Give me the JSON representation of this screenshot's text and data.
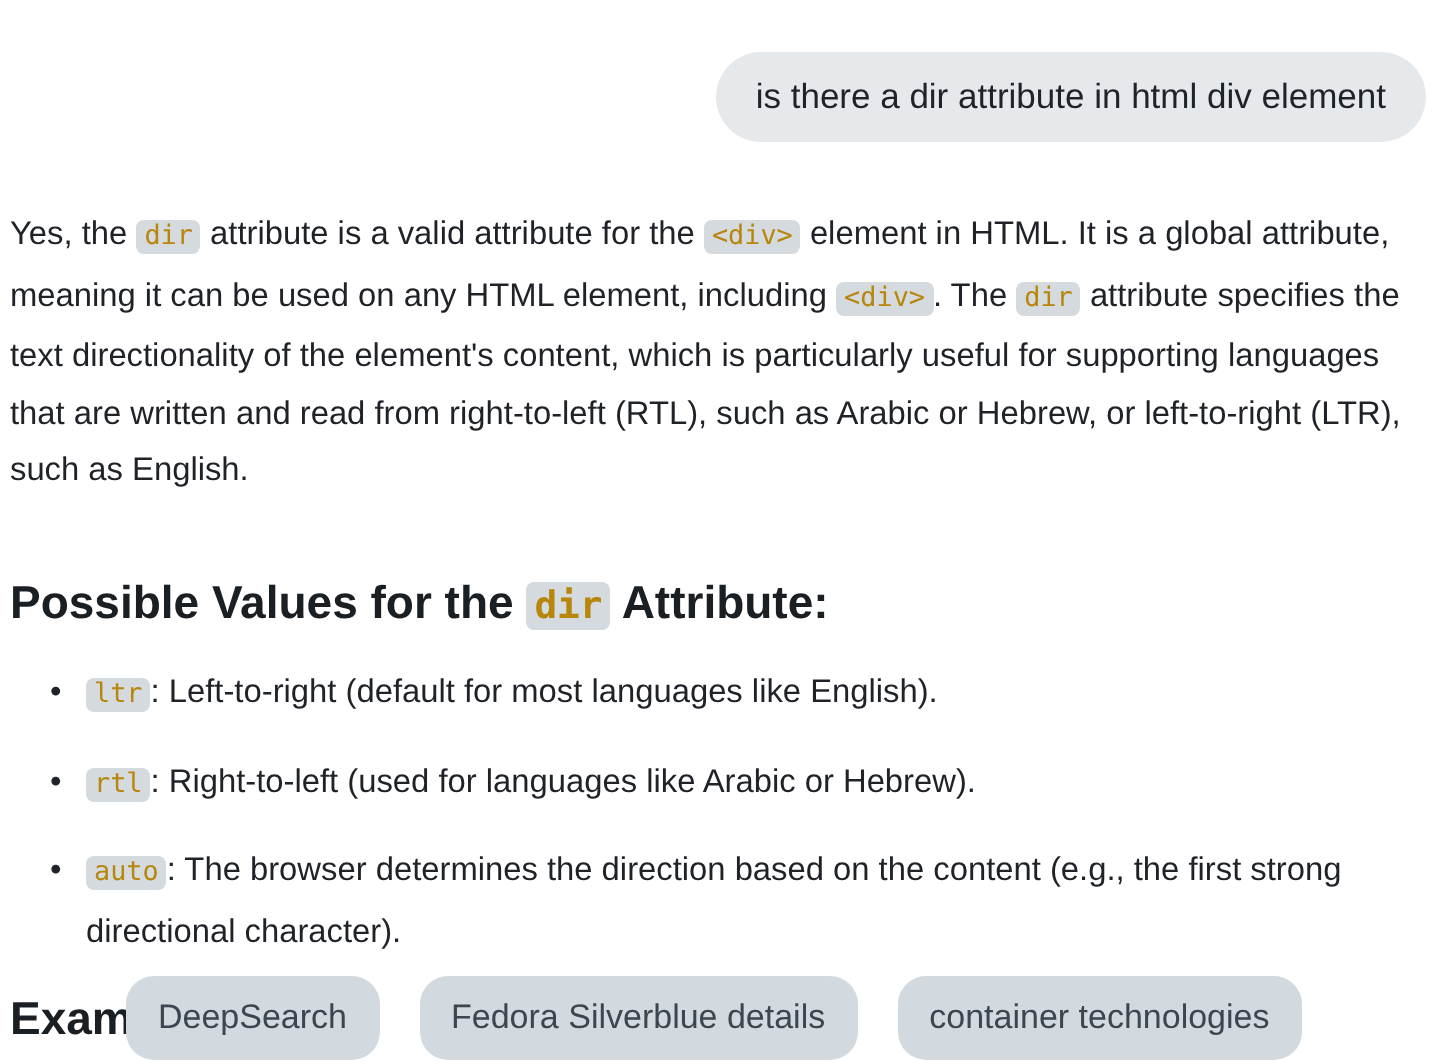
{
  "user_message": "is there a dir attribute in html div element",
  "answer": {
    "paragraph": [
      {
        "kind": "text",
        "text": "Yes, the "
      },
      {
        "kind": "code",
        "text": "dir"
      },
      {
        "kind": "text",
        "text": " attribute is a valid attribute for the "
      },
      {
        "kind": "code",
        "text": "<div>"
      },
      {
        "kind": "text",
        "text": " element in HTML. It is a global attribute, meaning it can be used on any HTML element, including "
      },
      {
        "kind": "code",
        "text": "<div>"
      },
      {
        "kind": "text",
        "text": ". The "
      },
      {
        "kind": "code",
        "text": "dir"
      },
      {
        "kind": "text",
        "text": " attribute specifies the text directionality of the element's content, which is particularly useful for supporting languages that are written and read from right-to-left (RTL), such as Arabic or Hebrew, or left-to-right (LTR), such as English."
      }
    ],
    "heading": [
      {
        "kind": "text",
        "text": "Possible Values for the "
      },
      {
        "kind": "code",
        "text": "dir"
      },
      {
        "kind": "text",
        "text": " Attribute:"
      }
    ],
    "list": [
      {
        "marker": "•",
        "content": [
          {
            "kind": "code",
            "text": "ltr"
          },
          {
            "kind": "text",
            "text": ": Left-to-right (default for most languages like English)."
          }
        ]
      },
      {
        "marker": "•",
        "content": [
          {
            "kind": "code",
            "text": "rtl"
          },
          {
            "kind": "text",
            "text": ": Right-to-left (used for languages like Arabic or Hebrew)."
          }
        ]
      },
      {
        "marker": "•",
        "content": [
          {
            "kind": "code",
            "text": "auto"
          },
          {
            "kind": "text",
            "text": ": The browser determines the direction based on the content (e.g., the first strong directional character)."
          }
        ]
      }
    ],
    "next_heading": "Exam"
  },
  "suggestions": [
    "DeepSearch",
    "Fedora Silverblue details",
    "container technologies"
  ]
}
